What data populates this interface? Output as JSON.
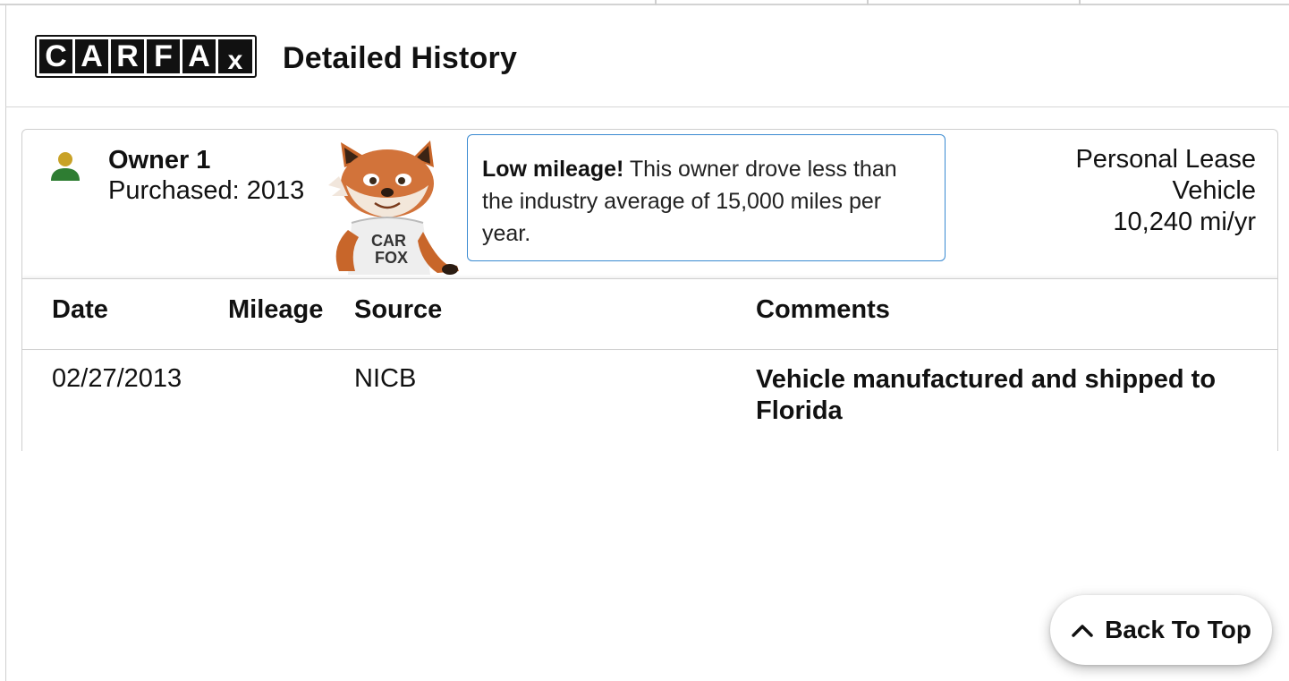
{
  "header": {
    "logo_letters": [
      "C",
      "A",
      "R",
      "F",
      "A",
      "x"
    ],
    "logo_text": "CARFAX",
    "title": "Detailed History"
  },
  "owner": {
    "name": "Owner 1",
    "purchased": "Purchased: 2013",
    "icon": "person-icon",
    "icon_colors": {
      "head": "#c9a227",
      "body": "#2e7d32"
    }
  },
  "callout": {
    "highlight": "Low mileage!",
    "text": " This owner drove less than the industry average of 15,000 miles per year.",
    "border_color": "#3a8ad1"
  },
  "lease": {
    "line1": "Personal Lease",
    "line2": "Vehicle",
    "line3": "10,240 mi/yr"
  },
  "mascot": {
    "shirt_text_1": "CAR",
    "shirt_text_2": "FOX"
  },
  "table": {
    "columns": [
      "Date",
      "Mileage",
      "Source",
      "Comments"
    ],
    "rows": [
      {
        "date": "02/27/2013",
        "mileage": "",
        "source": "NICB",
        "comments": "Vehicle manufactured and shipped to Florida"
      }
    ]
  },
  "back_to_top": {
    "label": "Back To Top",
    "icon": "chevron-up-icon"
  }
}
